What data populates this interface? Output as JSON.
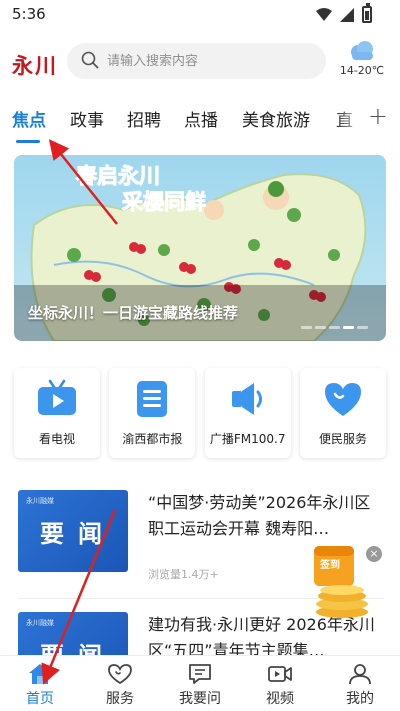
{
  "status_bar": {
    "time": "5:36"
  },
  "header": {
    "logo": "永川",
    "search_placeholder": "请输入搜索内容",
    "weather_temp": "14-20℃"
  },
  "tabs": [
    "焦点",
    "政事",
    "招聘",
    "点播",
    "美食旅游",
    "直"
  ],
  "tab_add_label": "+",
  "banner": {
    "headline_line1": "春启永川",
    "headline_line2": "采樱同鲜",
    "caption": "坐标永川！一日游宝藏路线推荐",
    "dots_total": 5,
    "dot_active_index": 3
  },
  "services": [
    {
      "label": "看电视",
      "icon": "tv-icon"
    },
    {
      "label": "渝西都市报",
      "icon": "newspaper-icon"
    },
    {
      "label": "广播FM100.7",
      "icon": "radio-icon"
    },
    {
      "label": "便民服务",
      "icon": "heart-service-icon"
    }
  ],
  "news": [
    {
      "thumb_tag": "永川融媒",
      "thumb_text": "要闻",
      "title": "“中国梦·劳动美”2026年永川区职工运动会开幕 魏寿阳…",
      "views": "浏览量1.4万+"
    },
    {
      "thumb_tag": "永川融媒",
      "thumb_text": "要闻",
      "title": "建功有我·永川更好 2026年永川区“五四”青年节主题集…",
      "views": ""
    }
  ],
  "checkin": {
    "label": "签到",
    "close": "×"
  },
  "bottom_nav": [
    {
      "label": "首页",
      "icon": "home-icon"
    },
    {
      "label": "服务",
      "icon": "service-heart-icon"
    },
    {
      "label": "我要问",
      "icon": "chat-icon"
    },
    {
      "label": "视频",
      "icon": "video-icon"
    },
    {
      "label": "我的",
      "icon": "profile-icon"
    }
  ],
  "colors": {
    "accent": "#1a7fd7",
    "logo": "#c8161d",
    "annotation_arrow": "#e02020"
  }
}
